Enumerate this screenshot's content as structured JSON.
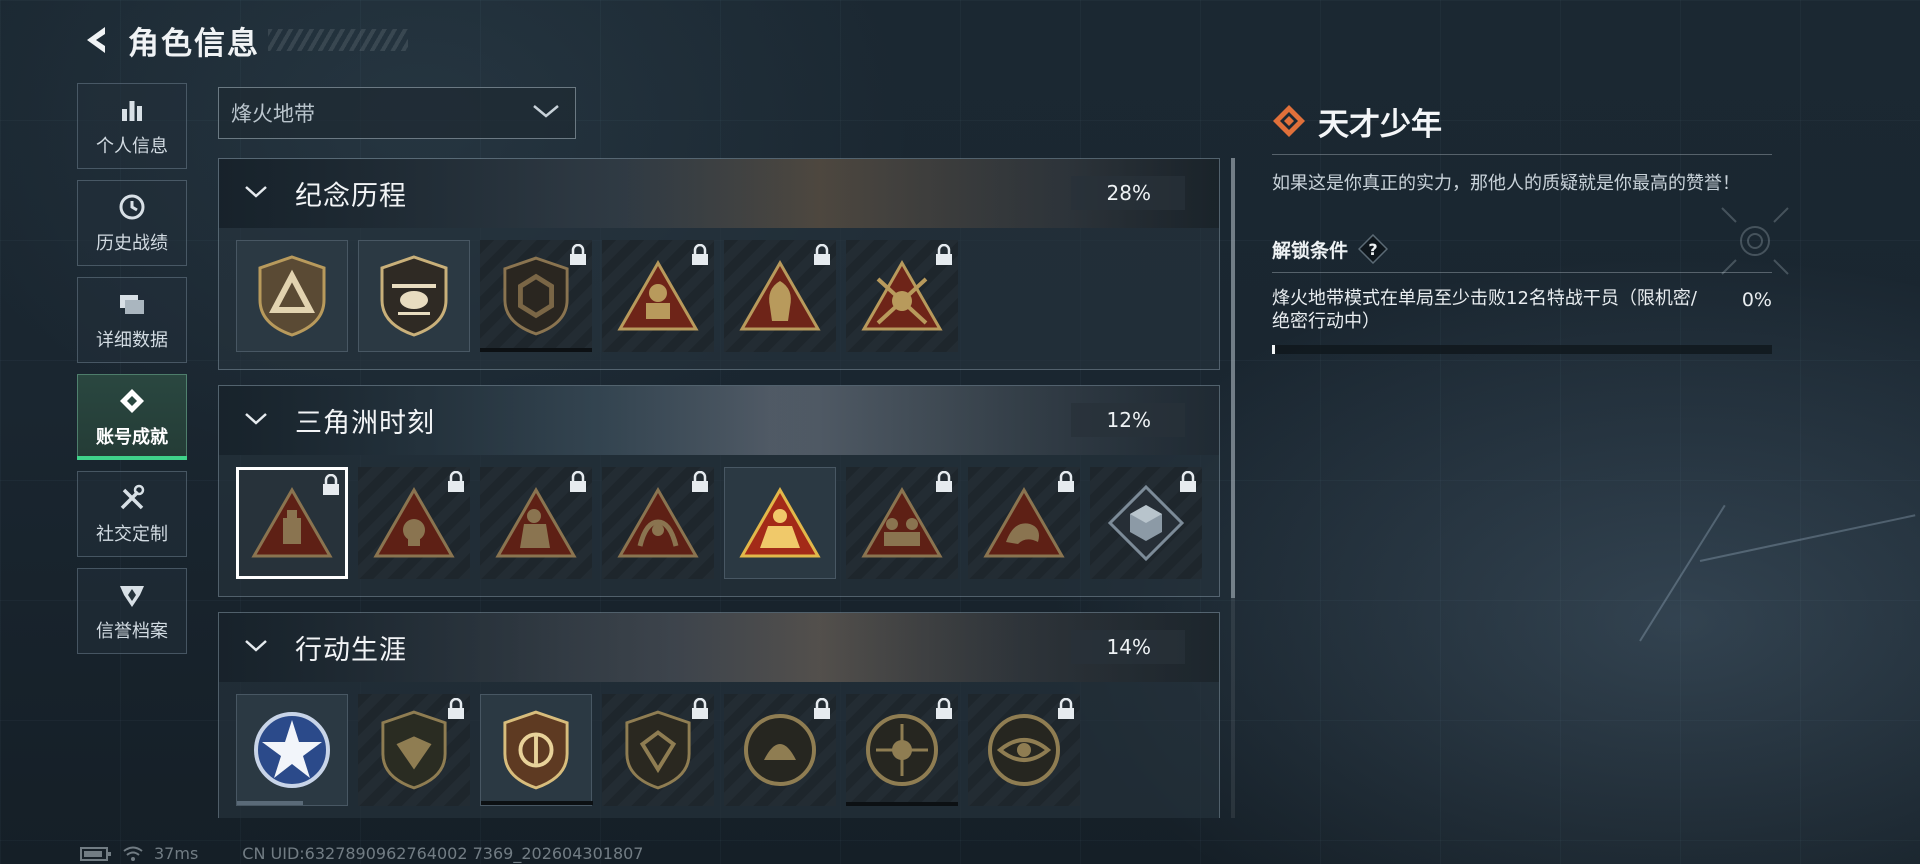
{
  "header": {
    "title": "角色信息"
  },
  "sidebar": {
    "items": [
      {
        "label": "个人信息",
        "icon": "bar-chart-icon"
      },
      {
        "label": "历史战绩",
        "icon": "clock-icon"
      },
      {
        "label": "详细数据",
        "icon": "folder-icon"
      },
      {
        "label": "账号成就",
        "icon": "achievement-icon",
        "active": true
      },
      {
        "label": "社交定制",
        "icon": "tools-icon"
      },
      {
        "label": "信誉档案",
        "icon": "shield-wing-icon"
      }
    ]
  },
  "mode_select": {
    "value": "烽火地带"
  },
  "sections": [
    {
      "title": "纪念历程",
      "progress": "28%",
      "badges": [
        {
          "icon": "triangle-emblem-icon",
          "locked": false
        },
        {
          "icon": "helicopter-emblem-icon",
          "locked": false
        },
        {
          "icon": "hexagon-emblem-icon",
          "locked": true
        },
        {
          "icon": "soldier-triangle-icon",
          "locked": true
        },
        {
          "icon": "operator-portrait-triangle-icon",
          "locked": true
        },
        {
          "icon": "crossed-rifles-triangle-icon",
          "locked": true
        }
      ]
    },
    {
      "title": "三角洲时刻",
      "progress": "12%",
      "badges": [
        {
          "icon": "crate-triangle-icon",
          "locked": true,
          "selected": true
        },
        {
          "icon": "skull-triangle-icon",
          "locked": true
        },
        {
          "icon": "kneeling-soldier-triangle-icon",
          "locked": true
        },
        {
          "icon": "hands-triangle-icon",
          "locked": true
        },
        {
          "icon": "squad-triangle-icon",
          "locked": false
        },
        {
          "icon": "team-triangle-icon",
          "locked": true
        },
        {
          "icon": "dragon-triangle-icon",
          "locked": true
        },
        {
          "icon": "cube-diamond-icon",
          "locked": true
        }
      ]
    },
    {
      "title": "行动生涯",
      "progress": "14%",
      "badges": [
        {
          "icon": "star-medal-icon",
          "locked": false
        },
        {
          "icon": "shield-eagle-icon",
          "locked": true
        },
        {
          "icon": "gold-shield-icon",
          "locked": false
        },
        {
          "icon": "gem-shield-icon",
          "locked": true
        },
        {
          "icon": "shell-coin-icon",
          "locked": true
        },
        {
          "icon": "crosshair-coin-icon",
          "locked": true
        },
        {
          "icon": "eye-coin-icon",
          "locked": true
        }
      ]
    }
  ],
  "detail": {
    "title": "天才少年",
    "description": "如果这是你真正的实力，那他人的质疑就是你最高的赞誉！",
    "unlock_title": "解锁条件",
    "condition": "烽火地带模式在单局至少击败12名特战干员（限机密/绝密行动中）",
    "condition_progress": "0%"
  },
  "footer": {
    "ping": "37ms",
    "uid": "CN UID:6327890962764002 7369_202604301807"
  },
  "colors": {
    "active_accent": "#3fd38a",
    "detail_icon": "#e0703a",
    "badge_gold": "#b89a5c",
    "badge_red": "#6e2418"
  }
}
